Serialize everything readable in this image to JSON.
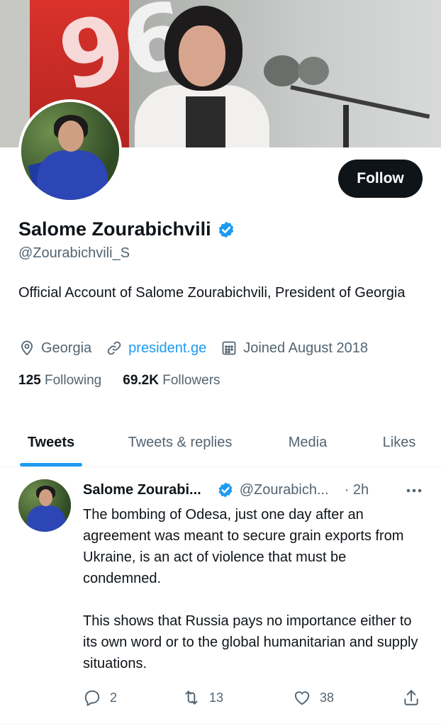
{
  "profile": {
    "name": "Salome Zourabichvili",
    "handle": "@Zourabichvili_S",
    "bio": "Official Account of Salome Zourabichvili, President of Georgia",
    "location": "Georgia",
    "website": "president.ge",
    "joined": "Joined August 2018",
    "follow_label": "Follow",
    "banner_number": "96"
  },
  "stats": {
    "following_count": "125",
    "following_label": "Following",
    "followers_count": "69.2K",
    "followers_label": "Followers"
  },
  "tabs": [
    {
      "label": "Tweets",
      "active": true
    },
    {
      "label": "Tweets & replies",
      "active": false
    },
    {
      "label": "Media",
      "active": false
    },
    {
      "label": "Likes",
      "active": false
    }
  ],
  "tweet": {
    "author_name": "Salome Zourabi...",
    "author_handle": "@Zourabich...",
    "time": "· 2h",
    "paragraphs": [
      "The bombing of Odesa, just one day after an agreement was meant to secure grain exports from Ukraine, is an act of violence that must be condemned.",
      "This shows that Russia pays no importance either to its own word or to the global humanitarian and supply situations."
    ],
    "replies": "2",
    "retweets": "13",
    "likes": "38"
  },
  "colors": {
    "accent": "#1d9bf0",
    "text_primary": "#0f1419",
    "text_secondary": "#536471",
    "button_bg": "#0f1419"
  },
  "icons": [
    "location-icon",
    "link-icon",
    "calendar-icon",
    "verified-badge-icon",
    "more-options-icon",
    "reply-icon",
    "retweet-icon",
    "like-icon",
    "share-icon"
  ]
}
